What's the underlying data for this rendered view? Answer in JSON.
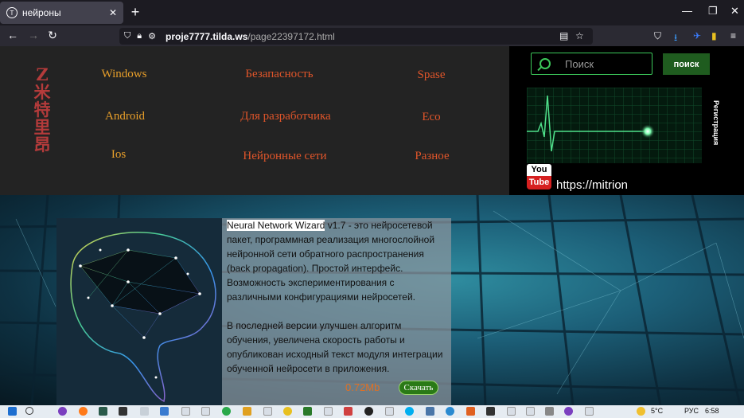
{
  "browser": {
    "tab_title": "нейроны",
    "tab_favicon": "tilda-icon",
    "url_host": "proje7777.tilda.ws",
    "url_path": "/page22397172.html",
    "window_controls": [
      "minimize-icon",
      "restore-icon",
      "close-icon"
    ]
  },
  "header": {
    "logo_text": "Z米特里昂",
    "menu": [
      {
        "label": "Windows",
        "color": "#e89f2a"
      },
      {
        "label": "Android",
        "color": "#e89f2a"
      },
      {
        "label": "Ios",
        "color": "#e89f2a"
      },
      {
        "label": "Безапасность",
        "color": "#e0552a"
      },
      {
        "label": "Для разработчика",
        "color": "#e0552a"
      },
      {
        "label": "Нейронные сети",
        "color": "#e0552a"
      },
      {
        "label": "Spase",
        "color": "#e0552a"
      },
      {
        "label": "Eco",
        "color": "#e0552a"
      },
      {
        "label": "Разное",
        "color": "#e0552a"
      }
    ]
  },
  "sidebar": {
    "search_placeholder": "Поиск",
    "search_button": "поиск",
    "register": "Регистрация",
    "youtube_top": "You",
    "youtube_bottom": "Tube",
    "link_text": "https://mitrion"
  },
  "content": {
    "title_selected": "Neural Network Wizard",
    "paragraph1_rest": " v1.7 - это нейросетевой пакет, программная реализация многослойной нейронной сети обратного распространения (back propagation). Простой интерфейс. Возможность экспериментирования с различными конфигурациями нейросетей.",
    "paragraph2": "В последней версии улучшен алгоритм обучения, увеличена скорость работы и опубликован исходный текст модуля интеграции обученной нейросети в приложения.",
    "file_size": "0.72Mb",
    "download_button": "Скачать"
  },
  "taskbar": {
    "temperature": "5°C",
    "language": "РУС",
    "time": "6:58"
  }
}
